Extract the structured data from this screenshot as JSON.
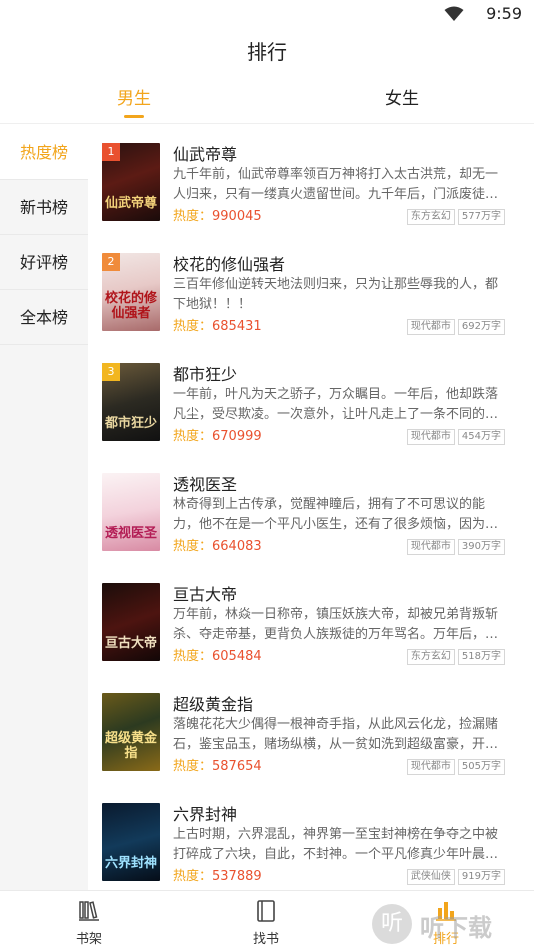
{
  "status": {
    "time": "9:59"
  },
  "header": {
    "title": "排行"
  },
  "gender_tabs": [
    {
      "label": "男生",
      "active": true
    },
    {
      "label": "女生",
      "active": false
    }
  ],
  "sidebar": {
    "items": [
      {
        "label": "热度榜",
        "active": true
      },
      {
        "label": "新书榜",
        "active": false
      },
      {
        "label": "好评榜",
        "active": false
      },
      {
        "label": "全本榜",
        "active": false
      }
    ]
  },
  "heat_label": "热度：",
  "books": [
    {
      "rank": "1",
      "title": "仙武帝尊",
      "desc": "九千年前，仙武帝尊率领百万神将打入太古洪荒，却无一人归来，只有一缕真火遗留世间。九千年后，门派废徒…",
      "heat": "990045",
      "genre": "东方玄幻",
      "words": "577万字",
      "cover_text": "仙武帝尊"
    },
    {
      "rank": "2",
      "title": "校花的修仙强者",
      "desc": "三百年修仙逆转天地法则归来，只为让那些辱我的人，都下地狱！！！",
      "heat": "685431",
      "genre": "现代都市",
      "words": "692万字",
      "cover_text": "校花的修仙强者"
    },
    {
      "rank": "3",
      "title": "都市狂少",
      "desc": "一年前，叶凡为天之骄子，万众瞩目。一年后，他却跌落凡尘，受尽欺凌。一次意外，让叶凡走上了一条不同的…",
      "heat": "670999",
      "genre": "现代都市",
      "words": "454万字",
      "cover_text": "都市狂少"
    },
    {
      "rank": "",
      "title": "透视医圣",
      "desc": "林奇得到上古传承，觉醒神瞳后，拥有了不可思议的能力，他不在是一个平凡小医生，还有了很多烦恼，因为…",
      "heat": "664083",
      "genre": "现代都市",
      "words": "390万字",
      "cover_text": "透视医圣"
    },
    {
      "rank": "",
      "title": "亘古大帝",
      "desc": "万年前，林焱一日称帝，镇压妖族大帝，却被兄弟背叛斩杀、夺走帝基，更背负人族叛徒的万年骂名。万年后，…",
      "heat": "605484",
      "genre": "东方玄幻",
      "words": "518万字",
      "cover_text": "亘古大帝"
    },
    {
      "rank": "",
      "title": "超级黄金指",
      "desc": "落魄花花大少偶得一根神奇手指，从此风云化龙，捡漏赌石，鉴宝品玉，赌场纵横，从一贫如洗到超级富豪，开…",
      "heat": "587654",
      "genre": "现代都市",
      "words": "505万字",
      "cover_text": "超级黄金指"
    },
    {
      "rank": "",
      "title": "六界封神",
      "desc": "上古时期，六界混乱，神界第一至宝封神榜在争夺之中被打碎成了六块，自此，不封神。一个平凡修真少年叶晨…",
      "heat": "537889",
      "genre": "武侠仙侠",
      "words": "919万字",
      "cover_text": "六界封神"
    }
  ],
  "bottom_nav": [
    {
      "label": "书架",
      "icon": "bookshelf-icon",
      "active": false
    },
    {
      "label": "找书",
      "icon": "book-icon",
      "active": false
    },
    {
      "label": "排行",
      "icon": "ranking-icon",
      "active": true
    }
  ],
  "watermark": {
    "text": "听下载",
    "glyph": "听"
  },
  "colors": {
    "accent": "#f2a51c",
    "heat_number": "#e9512f",
    "sidebar_bg": "#f5f5f5"
  }
}
